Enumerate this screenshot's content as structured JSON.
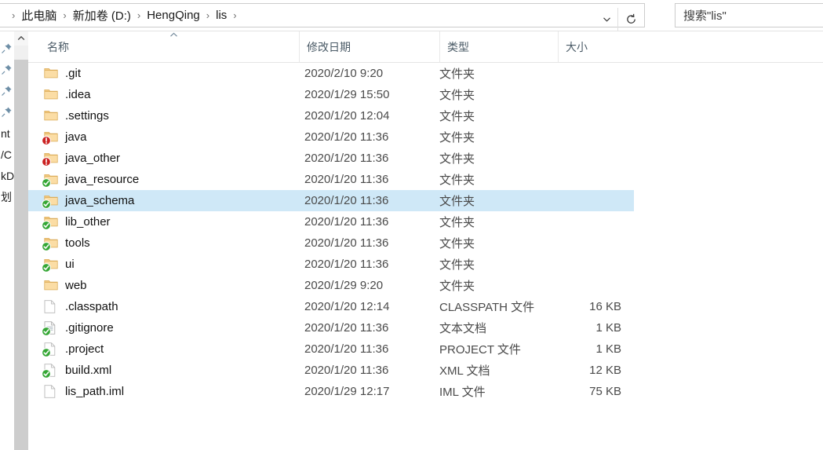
{
  "addressbar": {
    "breadcrumbs": [
      "此电脑",
      "新加卷 (D:)",
      "HengQing",
      "lis"
    ],
    "separator": "›",
    "dropdown_icon": "chevron-down-icon",
    "refresh_icon": "refresh-icon",
    "search_placeholder": "搜索\"lis\""
  },
  "navpane": {
    "items": [
      {
        "icon": "pin-icon",
        "label": ""
      },
      {
        "icon": "pin-icon",
        "label": ""
      },
      {
        "icon": "pin-icon",
        "label": ""
      },
      {
        "icon": "pin-icon",
        "label": ""
      },
      {
        "icon": "",
        "label": "nt"
      },
      {
        "icon": "",
        "label": "/C"
      },
      {
        "icon": "",
        "label": "kD"
      },
      {
        "icon": "",
        "label": "划"
      }
    ]
  },
  "scrollbar": {
    "up_arrow_icon": "chevron-up-icon"
  },
  "columns": {
    "name": "名称",
    "date": "修改日期",
    "type": "类型",
    "size": "大小",
    "sort_indicator": "sort-ascending-icon"
  },
  "colors": {
    "selection": "#cfe8f7",
    "folder": "#f6d493",
    "badge_green": "#31a531",
    "badge_red": "#cc2222"
  },
  "rows": [
    {
      "name": ".git",
      "date": "2020/2/10 9:20",
      "type": "文件夹",
      "size": "",
      "icon": "folder-icon",
      "badge": "none",
      "selected": false
    },
    {
      "name": ".idea",
      "date": "2020/1/29 15:50",
      "type": "文件夹",
      "size": "",
      "icon": "folder-icon",
      "badge": "none",
      "selected": false
    },
    {
      "name": ".settings",
      "date": "2020/1/20 12:04",
      "type": "文件夹",
      "size": "",
      "icon": "folder-icon",
      "badge": "none",
      "selected": false
    },
    {
      "name": "java",
      "date": "2020/1/20 11:36",
      "type": "文件夹",
      "size": "",
      "icon": "folder-icon",
      "badge": "red",
      "selected": false
    },
    {
      "name": "java_other",
      "date": "2020/1/20 11:36",
      "type": "文件夹",
      "size": "",
      "icon": "folder-icon",
      "badge": "red",
      "selected": false
    },
    {
      "name": "java_resource",
      "date": "2020/1/20 11:36",
      "type": "文件夹",
      "size": "",
      "icon": "folder-icon",
      "badge": "green",
      "selected": false
    },
    {
      "name": "java_schema",
      "date": "2020/1/20 11:36",
      "type": "文件夹",
      "size": "",
      "icon": "folder-icon",
      "badge": "green",
      "selected": true
    },
    {
      "name": "lib_other",
      "date": "2020/1/20 11:36",
      "type": "文件夹",
      "size": "",
      "icon": "folder-icon",
      "badge": "green",
      "selected": false
    },
    {
      "name": "tools",
      "date": "2020/1/20 11:36",
      "type": "文件夹",
      "size": "",
      "icon": "folder-icon",
      "badge": "green",
      "selected": false
    },
    {
      "name": "ui",
      "date": "2020/1/20 11:36",
      "type": "文件夹",
      "size": "",
      "icon": "folder-icon",
      "badge": "green",
      "selected": false
    },
    {
      "name": "web",
      "date": "2020/1/29 9:20",
      "type": "文件夹",
      "size": "",
      "icon": "folder-icon",
      "badge": "none",
      "selected": false
    },
    {
      "name": ".classpath",
      "date": "2020/1/20 12:14",
      "type": "CLASSPATH 文件",
      "size": "16 KB",
      "icon": "document-icon",
      "badge": "none",
      "selected": false
    },
    {
      "name": ".gitignore",
      "date": "2020/1/20 11:36",
      "type": "文本文档",
      "size": "1 KB",
      "icon": "text-file-icon",
      "badge": "green",
      "selected": false
    },
    {
      "name": ".project",
      "date": "2020/1/20 11:36",
      "type": "PROJECT 文件",
      "size": "1 KB",
      "icon": "document-icon",
      "badge": "green",
      "selected": false
    },
    {
      "name": "build.xml",
      "date": "2020/1/20 11:36",
      "type": "XML 文档",
      "size": "12 KB",
      "icon": "document-icon",
      "badge": "green",
      "selected": false
    },
    {
      "name": "lis_path.iml",
      "date": "2020/1/29 12:17",
      "type": "IML 文件",
      "size": "75 KB",
      "icon": "document-icon",
      "badge": "none",
      "selected": false
    }
  ]
}
